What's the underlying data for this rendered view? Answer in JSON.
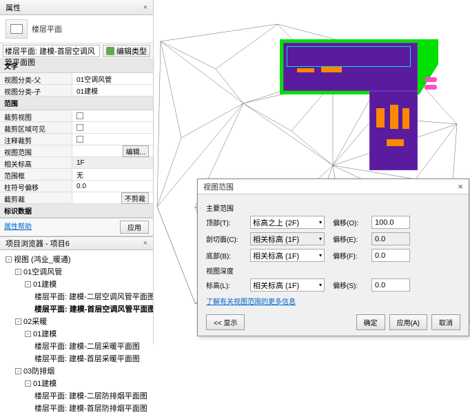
{
  "props": {
    "title": "属性",
    "type_label": "楼层平面",
    "filter_value": "楼层平面: 建模-首层空调风管平面图",
    "filter_btn": "编辑类型",
    "sections": [
      {
        "header": "文字",
        "rows": [
          {
            "label": "视图分类-父",
            "value": "01空调风管",
            "type": "text"
          },
          {
            "label": "视图分类-子",
            "value": "01建模",
            "type": "text"
          }
        ]
      },
      {
        "header": "范围",
        "rows": [
          {
            "label": "裁剪视图",
            "type": "check",
            "checked": false
          },
          {
            "label": "裁剪区域可见",
            "type": "check",
            "checked": false
          },
          {
            "label": "注释裁剪",
            "type": "check",
            "checked": false
          },
          {
            "label": "视图范围",
            "type": "button",
            "btn": "编辑..."
          },
          {
            "label": "相关标高",
            "value": "1F",
            "type": "readonly"
          },
          {
            "label": "范围框",
            "value": "无",
            "type": "text"
          },
          {
            "label": "柱符号偏移",
            "value": "0.0",
            "type": "text"
          },
          {
            "label": "截剪裁",
            "type": "button",
            "btn": "不剪裁"
          }
        ]
      },
      {
        "header": "标识数据",
        "rows": []
      }
    ],
    "help_link": "属性帮助",
    "apply": "应用"
  },
  "browser": {
    "title": "项目浏览器 - 项目6",
    "items": [
      {
        "lvl": 1,
        "toggle": "-",
        "label": "视图 (鸿业_暖通)"
      },
      {
        "lvl": 2,
        "toggle": "-",
        "label": "01空调风管"
      },
      {
        "lvl": 3,
        "toggle": "-",
        "label": "01建模"
      },
      {
        "lvl": 4,
        "label": "楼层平面: 建模-二层空调风管平面图"
      },
      {
        "lvl": 4,
        "label": "楼层平面: 建模-首层空调风管平面图",
        "bold": true
      },
      {
        "lvl": 2,
        "toggle": "-",
        "label": "02采暖"
      },
      {
        "lvl": 3,
        "toggle": "-",
        "label": "01建模"
      },
      {
        "lvl": 4,
        "label": "楼层平面: 建模-二层采暖平面图"
      },
      {
        "lvl": 4,
        "label": "楼层平面: 建模-首层采暖平面图"
      },
      {
        "lvl": 2,
        "toggle": "-",
        "label": "03防排烟"
      },
      {
        "lvl": 3,
        "toggle": "-",
        "label": "01建模"
      },
      {
        "lvl": 4,
        "label": "楼层平面: 建模-二层防排烟平面图"
      },
      {
        "lvl": 4,
        "label": "楼层平面: 建模-首层防排烟平面图"
      }
    ]
  },
  "dialog": {
    "title": "视图范围",
    "section1": "主要范围",
    "section2": "视图深度",
    "rows": [
      {
        "label": "顶部(T):",
        "select": "标高之上 (2F)",
        "offset_label": "偏移(O):",
        "offset": "100.0"
      },
      {
        "label": "剖切面(C):",
        "select": "相关标高 (1F)",
        "offset_label": "偏移(E):",
        "offset": "0.0",
        "disabled": true
      },
      {
        "label": "底部(B):",
        "select": "相关标高 (1F)",
        "offset_label": "偏移(F):",
        "offset": "0.0"
      }
    ],
    "depth_row": {
      "label": "标高(L):",
      "select": "相关标高 (1F)",
      "offset_label": "偏移(S):",
      "offset": "0.0"
    },
    "link": "了解有关视图范围的更多信息",
    "buttons": {
      "show": "<< 显示",
      "ok": "确定",
      "apply": "应用(A)",
      "cancel": "取消"
    }
  }
}
